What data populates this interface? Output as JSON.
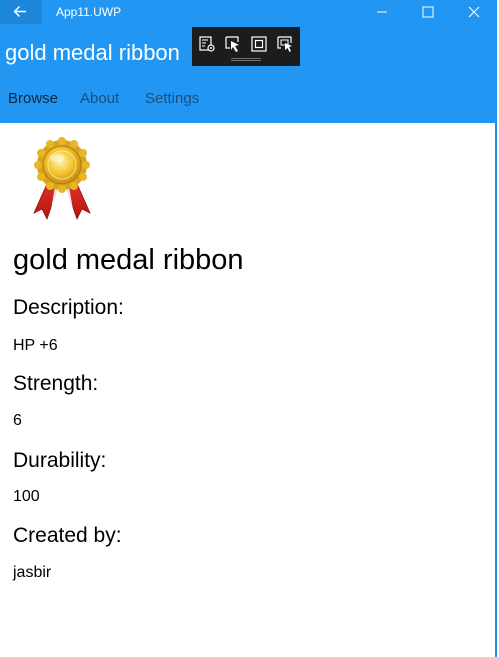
{
  "window": {
    "title": "App11.UWP",
    "accent_color": "#2196f3",
    "back_icon": "arrow-left-icon",
    "controls": [
      "minimize-icon",
      "maximize-icon",
      "close-icon"
    ]
  },
  "header": {
    "title": "gold medal ribbon",
    "tabs": [
      {
        "label": "Browse",
        "selected": true
      },
      {
        "label": "About",
        "selected": false
      },
      {
        "label": "Settings",
        "selected": false
      }
    ]
  },
  "debug_toolbar": {
    "icons": [
      "live-visual-tree-icon",
      "select-element-icon",
      "display-layout-adorners-icon",
      "track-focus-icon"
    ]
  },
  "item": {
    "image_icon": "gold-medal-ribbon-icon",
    "name": "gold medal ribbon",
    "fields": [
      {
        "label": "Description:",
        "value": "HP +6"
      },
      {
        "label": "Strength:",
        "value": "6"
      },
      {
        "label": "Durability:",
        "value": "100"
      },
      {
        "label": "Created by:",
        "value": "jasbir"
      }
    ]
  }
}
